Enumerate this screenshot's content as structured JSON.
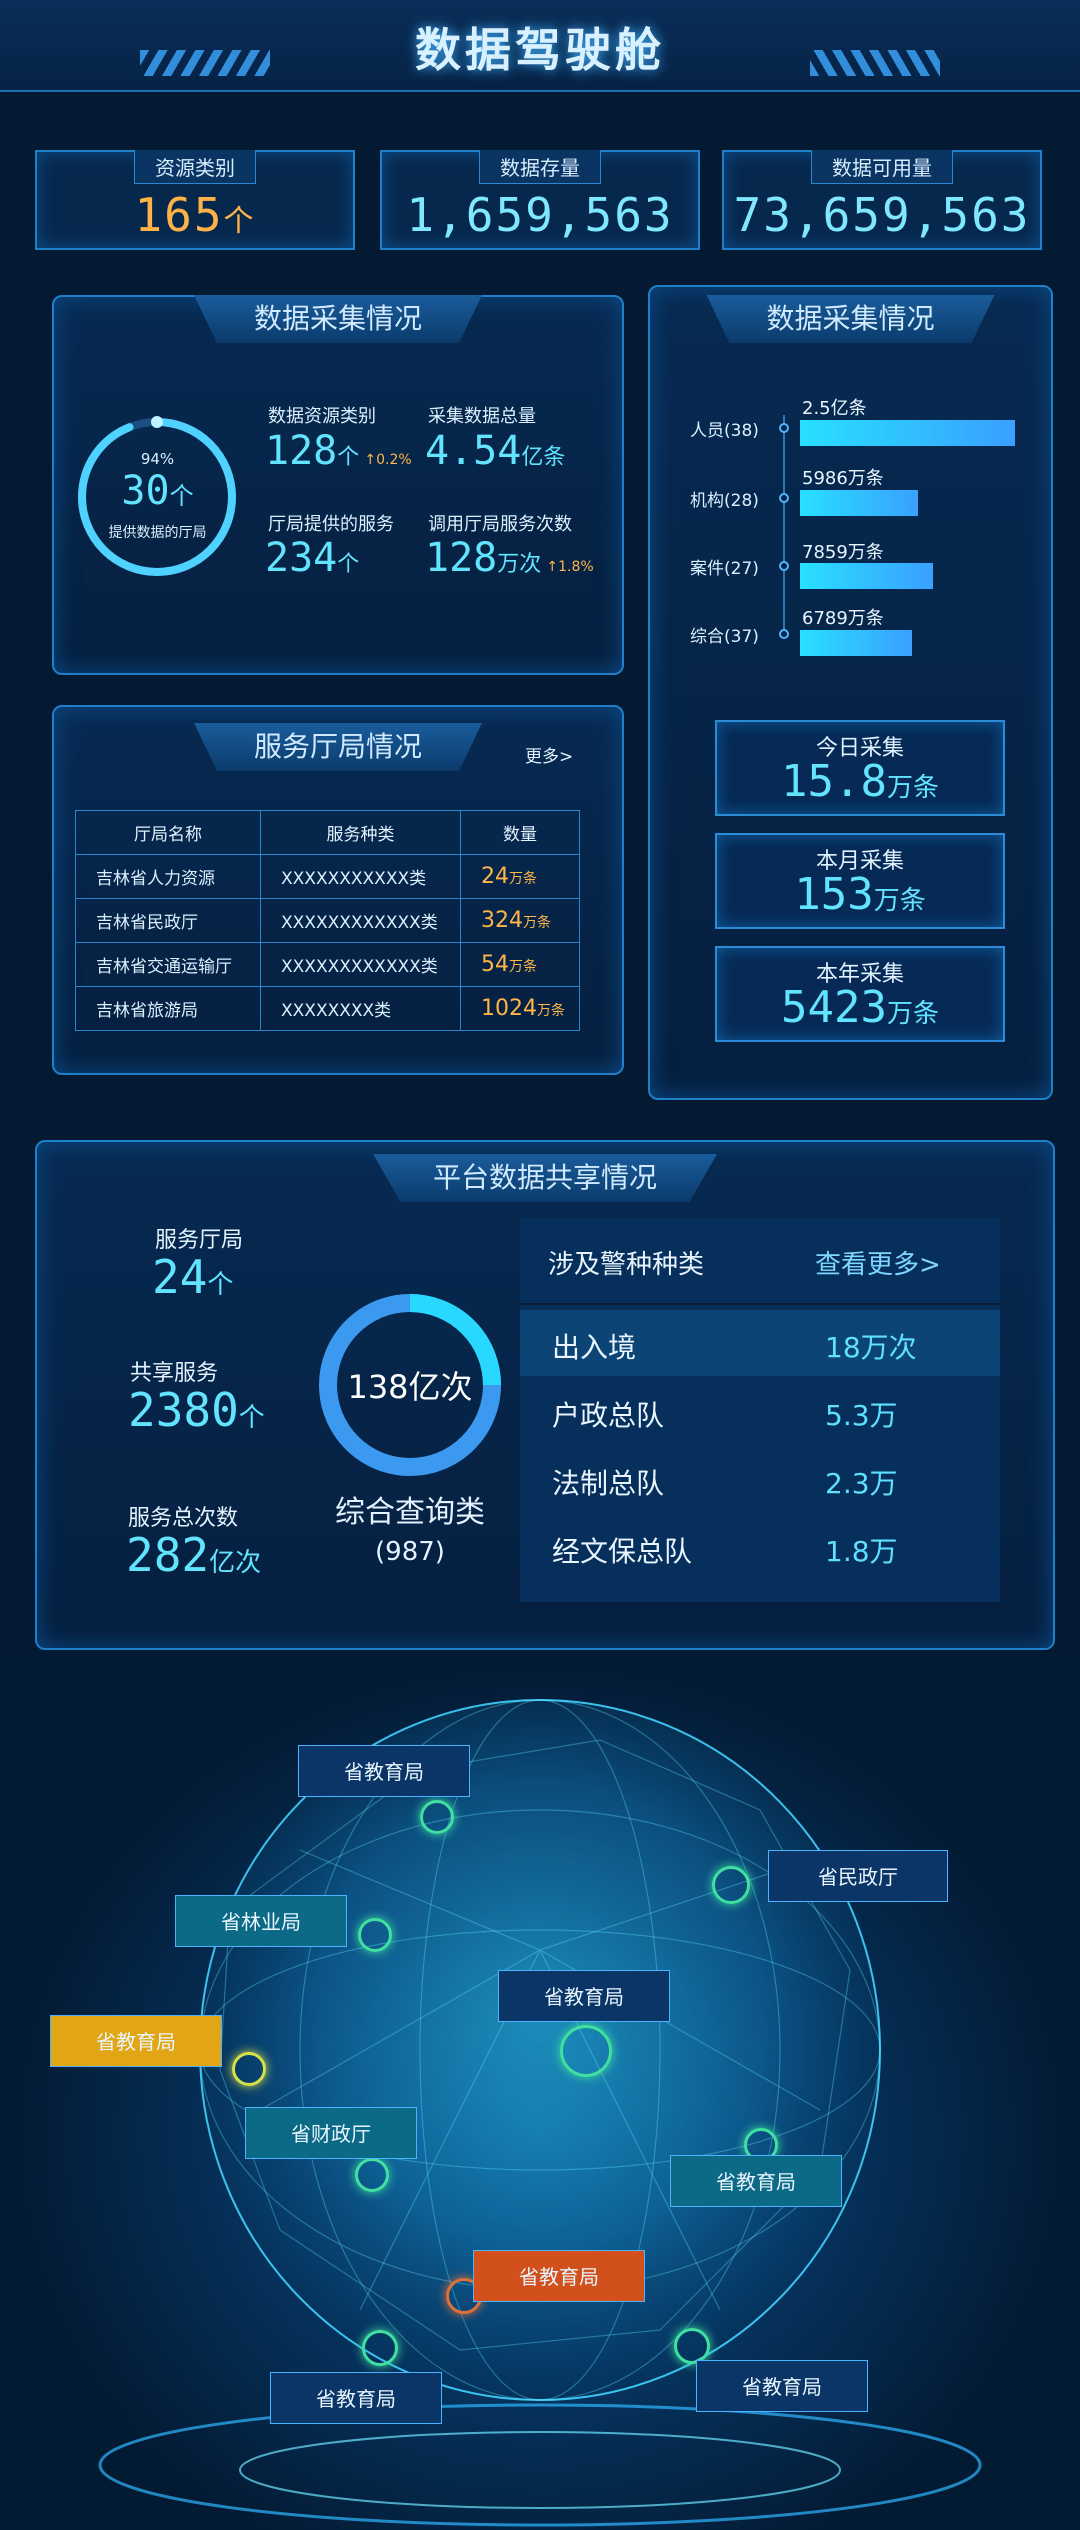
{
  "header": {
    "title": "数据驾驶舱"
  },
  "kpis": [
    {
      "label": "资源类别",
      "value": "165",
      "unit": "个"
    },
    {
      "label": "数据存量",
      "value": "1,659,563",
      "unit": ""
    },
    {
      "label": "数据可用量",
      "value": "73,659,563",
      "unit": ""
    }
  ],
  "collect_left": {
    "title": "数据采集情况",
    "ring_percent_text": "94%",
    "ring_value": "30",
    "ring_unit": "个",
    "ring_caption": "提供数据的厅局",
    "ring_fraction": 0.94,
    "metrics": [
      {
        "label": "数据资源类别",
        "value": "128",
        "unit": "个",
        "change": "↑",
        "change_value": "0.2%"
      },
      {
        "label": "采集数据总量",
        "value": "4.54",
        "unit": "亿条",
        "change": "",
        "change_value": ""
      },
      {
        "label": "厅局提供的服务",
        "value": "234",
        "unit": "个",
        "change": "",
        "change_value": ""
      },
      {
        "label": "调用厅局服务次数",
        "value": "128",
        "unit": "万次",
        "change": "↑",
        "change_value": "1.8%"
      }
    ]
  },
  "collect_right": {
    "title": "数据采集情况",
    "bars": [
      {
        "label": "人员(38)",
        "value_text": "2.5亿条",
        "fraction": 1.0
      },
      {
        "label": "机构(28)",
        "value_text": "5986万条",
        "fraction": 0.55
      },
      {
        "label": "案件(27)",
        "value_text": "7859万条",
        "fraction": 0.62
      },
      {
        "label": "综合(37)",
        "value_text": "6789万条",
        "fraction": 0.52
      }
    ],
    "stats": [
      {
        "label": "今日采集",
        "value": "15.8",
        "unit": "万条"
      },
      {
        "label": "本月采集",
        "value": "153",
        "unit": "万条"
      },
      {
        "label": "本年采集",
        "value": "5423",
        "unit": "万条"
      }
    ]
  },
  "service": {
    "title": "服务厅局情况",
    "more": "更多>",
    "headers": [
      "厅局名称",
      "服务种类",
      "数量"
    ],
    "rows": [
      {
        "name": "吉林省人力资源",
        "kind": "XXXXXXXXXXX类",
        "count": "24",
        "unit": "万条"
      },
      {
        "name": "吉林省民政厅",
        "kind": "XXXXXXXXXXXX类",
        "count": "324",
        "unit": "万条"
      },
      {
        "name": "吉林省交通运输厅",
        "kind": "XXXXXXXXXXXX类",
        "count": "54",
        "unit": "万条"
      },
      {
        "name": "吉林省旅游局",
        "kind": "XXXXXXXX类",
        "count": "1024",
        "unit": "万条"
      }
    ]
  },
  "share": {
    "title": "平台数据共享情况",
    "left_stats": [
      {
        "label": "服务厅局",
        "value": "24",
        "unit": "个"
      },
      {
        "label": "共享服务",
        "value": "2380",
        "unit": "个"
      },
      {
        "label": "服务总次数",
        "value": "282",
        "unit": "亿次"
      }
    ],
    "donut_value": "138亿次",
    "donut_caption": "综合查询类",
    "donut_sub": "(987)",
    "list_header": "涉及警种种类",
    "list_more": "查看更多>",
    "list": [
      {
        "name": "出入境",
        "value": "18万次"
      },
      {
        "name": "户政总队",
        "value": "5.3万"
      },
      {
        "name": "法制总队",
        "value": "2.3万"
      },
      {
        "name": "经文保总队",
        "value": "1.8万"
      }
    ]
  },
  "globe_tags": [
    {
      "label": "省教育局",
      "color": "#0b3566"
    },
    {
      "label": "省民政厅",
      "color": "#0b3566"
    },
    {
      "label": "省林业局",
      "color": "#0d6a86"
    },
    {
      "label": "省教育局",
      "color": "#0b3566"
    },
    {
      "label": "省教育局",
      "color": "#e2a514"
    },
    {
      "label": "省财政厅",
      "color": "#0d6a86"
    },
    {
      "label": "省教育局",
      "color": "#0d6a86"
    },
    {
      "label": "省教育局",
      "color": "#d2501c"
    },
    {
      "label": "省教育局",
      "color": "#0b3566"
    },
    {
      "label": "省教育局",
      "color": "#0b3566"
    }
  ]
}
